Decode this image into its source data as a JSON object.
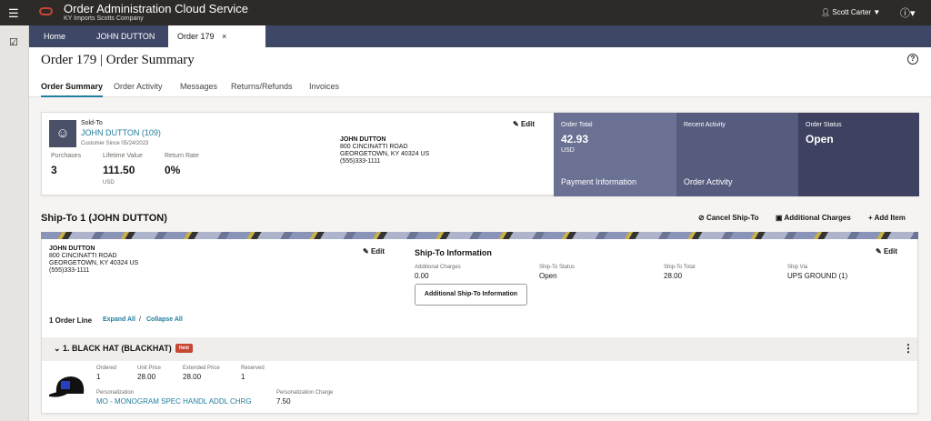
{
  "header": {
    "title": "Order Administration Cloud Service",
    "subtitle": "KY Imports Scotts Company",
    "user": "Scott Carter"
  },
  "tabs": [
    {
      "label": "Home"
    },
    {
      "label": "JOHN DUTTON"
    },
    {
      "label": "Order 179"
    }
  ],
  "page_title": "Order 179 | Order Summary",
  "subtabs": [
    "Order Summary",
    "Order Activity",
    "Messages",
    "Returns/Refunds",
    "Invoices"
  ],
  "sold_to": {
    "label": "Sold-To",
    "name": "JOHN DUTTON (109)",
    "since": "Customer Since 05/24/2023",
    "purchases_label": "Purchases",
    "purchases": "3",
    "lifetime_label": "Lifetime Value",
    "lifetime": "111.50",
    "lifetime_currency": "USD",
    "return_label": "Return Rate",
    "return_rate": "0%",
    "edit": "Edit",
    "address": [
      "JOHN DUTTON",
      "800 CINCINATTI ROAD",
      "GEORGETOWN, KY 40324 US",
      "(555)333-1111"
    ]
  },
  "tiles": {
    "total_label": "Order Total",
    "total": "42.93",
    "currency": "USD",
    "payment": "Payment Information",
    "recent_label": "Recent Activity",
    "activity": "Order Activity",
    "status_label": "Order Status",
    "status": "Open"
  },
  "ship_to": {
    "title": "Ship-To 1 (JOHN DUTTON)",
    "cancel": "Cancel Ship-To",
    "charges": "Additional Charges",
    "add_item": "Add Item",
    "address": [
      "JOHN DUTTON",
      "800 CINCINATTI ROAD",
      "GEORGETOWN, KY 40324 US",
      "(555)333-1111"
    ],
    "edit": "Edit",
    "info_title": "Ship-To Information",
    "add_charges_label": "Additional Charges",
    "add_charges": "0.00",
    "status_label": "Ship-To Status",
    "status": "Open",
    "total_label": "Ship-To Total",
    "total": "28.00",
    "via_label": "Ship Via",
    "via": "UPS GROUND (1)",
    "more_btn": "Additional Ship-To Information",
    "order_lines": "1 Order Line",
    "expand": "Expand All",
    "sep": "/",
    "collapse": "Collapse All"
  },
  "line": {
    "title": "1. BLACK HAT (BLACKHAT)",
    "badge": "Held",
    "ordered_label": "Ordered",
    "ordered": "1",
    "unit_label": "Unit Price",
    "unit": "28.00",
    "ext_label": "Extended Price",
    "ext": "28.00",
    "reserved_label": "Reserved",
    "reserved": "1",
    "pers_label": "Personalization",
    "pers": "MO - MONOGRAM SPEC HANDL ADDL CHRG",
    "pers_charge_label": "Personalization Charge",
    "pers_charge": "7.50"
  },
  "colors": {
    "topbar": "#2e2a27",
    "tabbar": "#3f4766",
    "link": "#227e9e",
    "badge": "#c74634",
    "tile1": "#6b7192",
    "tile2": "#565c7e",
    "tile3": "#3e4260"
  }
}
